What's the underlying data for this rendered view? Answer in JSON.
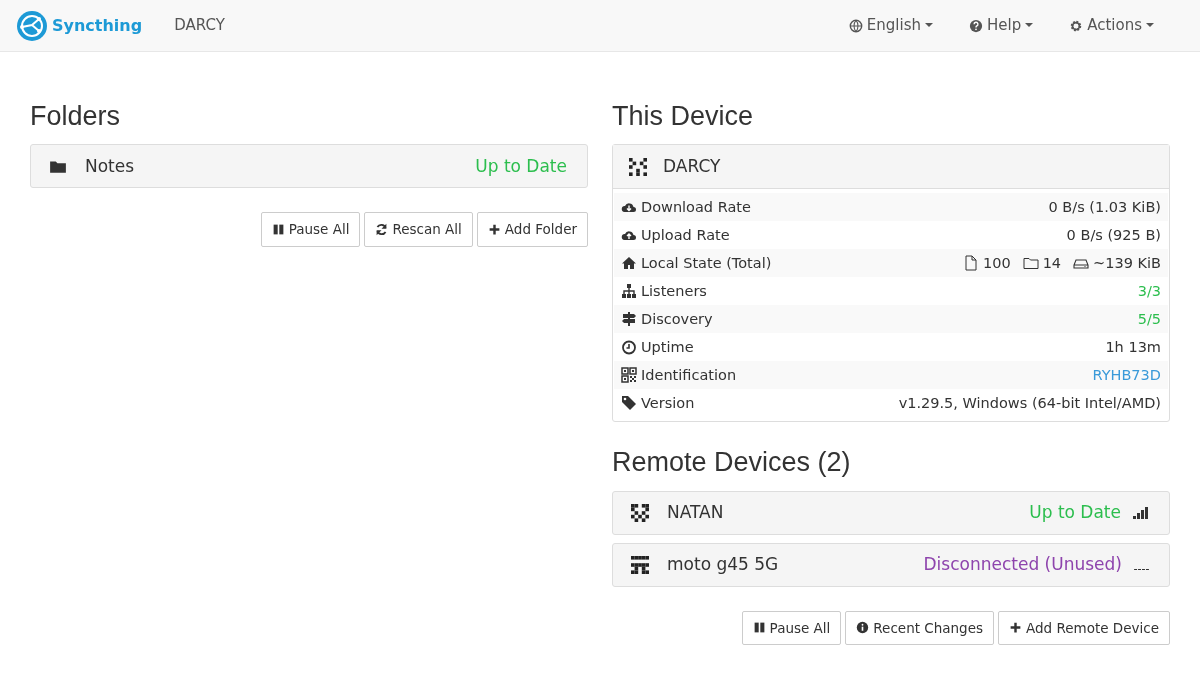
{
  "navbar": {
    "brand": "Syncthing",
    "device_name": "DARCY",
    "menus": [
      {
        "kind": "globe",
        "label": "English"
      },
      {
        "kind": "help",
        "label": "Help"
      },
      {
        "kind": "gear",
        "label": "Actions"
      }
    ]
  },
  "folders": {
    "title": "Folders",
    "items": [
      {
        "name": "Notes",
        "status": "Up to Date",
        "color": "#2cbe4e"
      }
    ],
    "buttons": [
      {
        "kind": "pause",
        "label": "Pause All"
      },
      {
        "kind": "rescan",
        "label": "Rescan All"
      },
      {
        "kind": "add",
        "label": "Add Folder"
      }
    ]
  },
  "this_device": {
    "title": "This Device",
    "name": "DARCY",
    "rows": [
      {
        "kind": "download",
        "label": "Download Rate",
        "value": "0 B/s (1.03 KiB)"
      },
      {
        "kind": "upload",
        "label": "Upload Rate",
        "value": "0 B/s (925 B)"
      },
      {
        "kind": "local",
        "label": "Local State (Total)",
        "parts": [
          {
            "kind": "file",
            "text": "100"
          },
          {
            "kind": "folder",
            "text": "14"
          },
          {
            "kind": "drive",
            "text": "~139 KiB"
          }
        ]
      },
      {
        "kind": "listeners",
        "label": "Listeners",
        "value": "3/3",
        "color": "#2cbe4e"
      },
      {
        "kind": "discovery",
        "label": "Discovery",
        "value": "5/5",
        "color": "#2cbe4e"
      },
      {
        "kind": "uptime",
        "label": "Uptime",
        "value": "1h 13m"
      },
      {
        "kind": "id",
        "label": "Identification",
        "value": "RYHB73D",
        "color": "#3a9ad9"
      },
      {
        "kind": "version",
        "label": "Version",
        "value": "v1.29.5, Windows (64-bit Intel/AMD)"
      }
    ]
  },
  "remote_devices": {
    "title": "Remote Devices (2)",
    "items": [
      {
        "name": "NATAN",
        "status": "Up to Date",
        "color": "#2cbe4e",
        "connected": true
      },
      {
        "name": "moto g45 5G",
        "status": "Disconnected (Unused)",
        "color": "#8e44ad",
        "connected": false
      }
    ],
    "buttons": [
      {
        "kind": "pause",
        "label": "Pause All"
      },
      {
        "kind": "info",
        "label": "Recent Changes"
      },
      {
        "kind": "add",
        "label": "Add Remote Device"
      }
    ]
  }
}
